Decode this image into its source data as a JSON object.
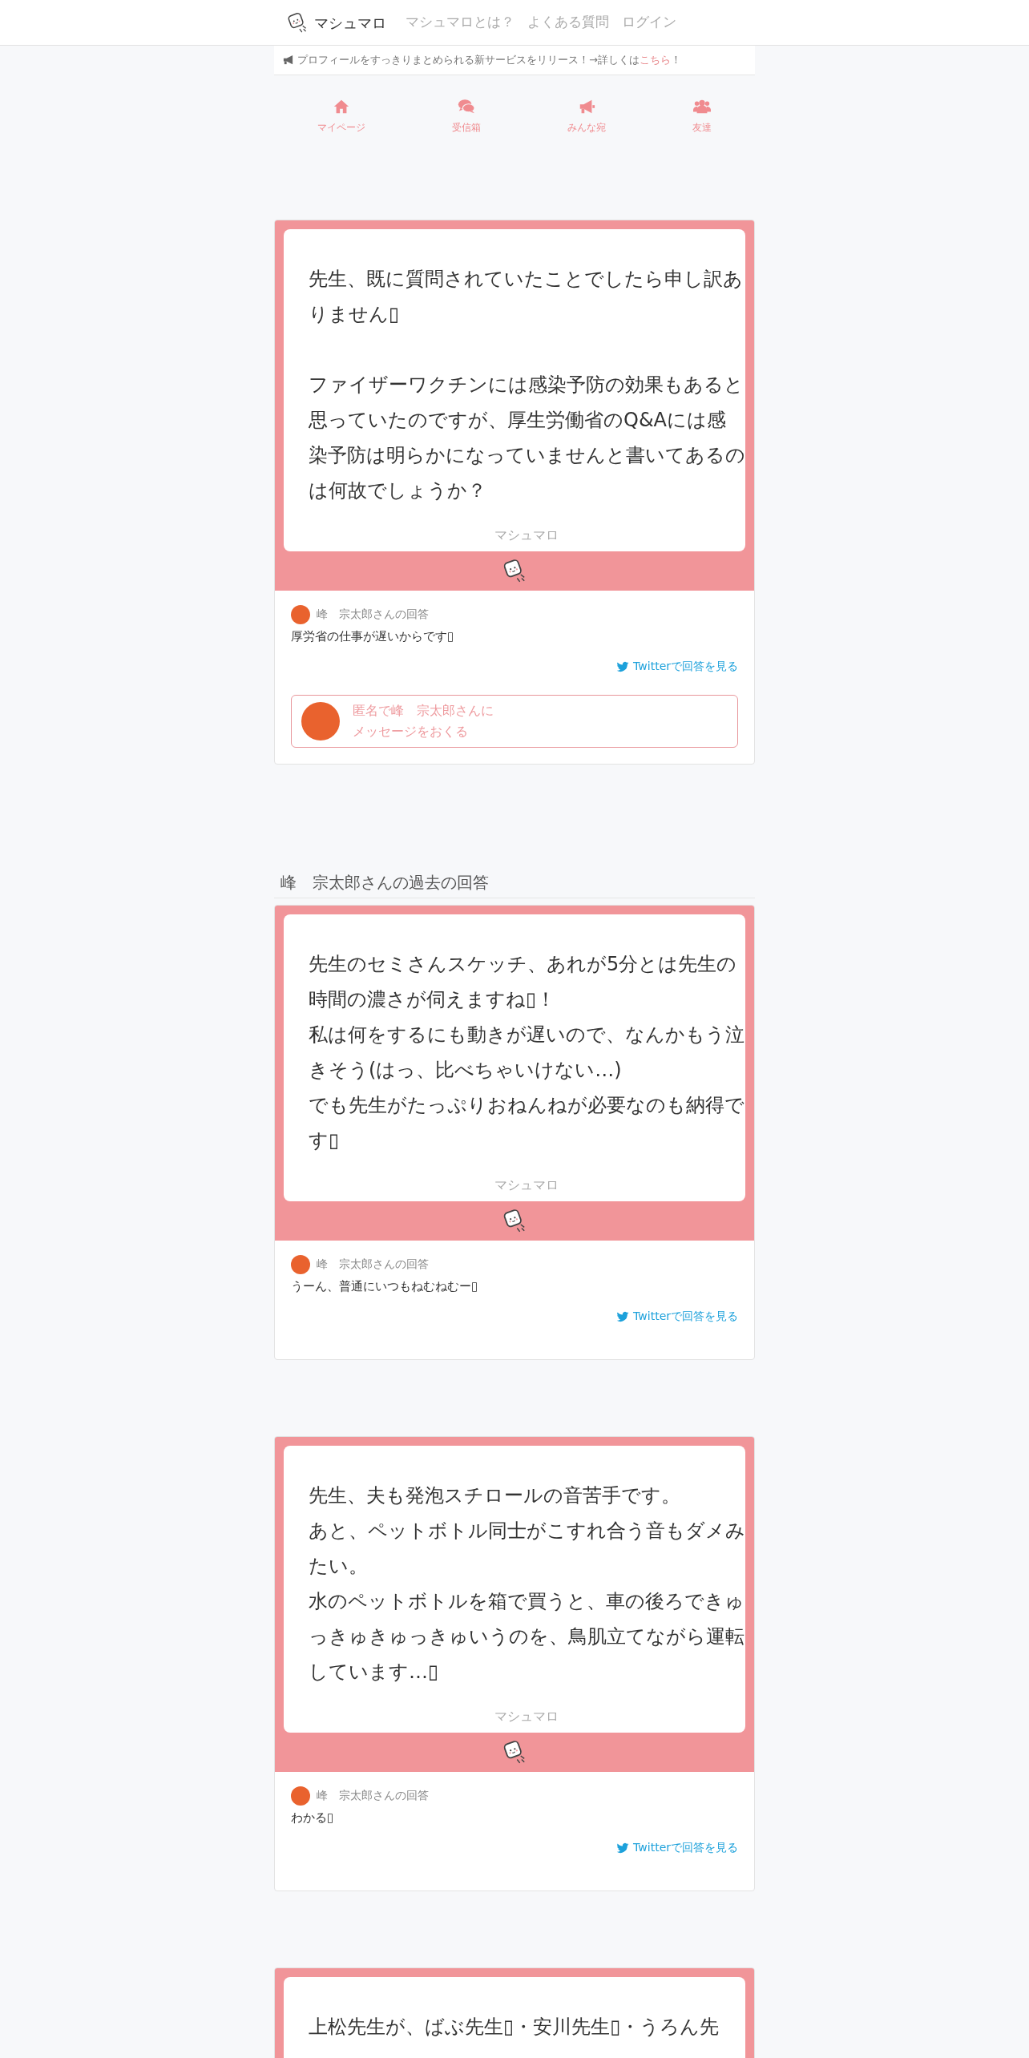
{
  "navbar": {
    "brand": "マシュマロ",
    "links": [
      "マシュマロとは？",
      "よくある質問",
      "ログイン"
    ]
  },
  "notice": {
    "text": "プロフィールをすっきりまとめられる新サービスをリリース！→詳しくは",
    "link": "こちら",
    "suffix": "！"
  },
  "tabs": [
    {
      "label": "マイページ",
      "kind": "home"
    },
    {
      "label": "受信箱",
      "kind": "chat"
    },
    {
      "label": "みんな宛",
      "kind": "megaphone"
    },
    {
      "label": "友達",
      "kind": "people"
    }
  ],
  "featured": {
    "question": [
      [
        "先生、既に質問されていたことでしたら申し訳ありません▯"
      ],
      [
        "ファイザーワクチンには感染予防の効果もあると思っていたのですが、厚生労働省のQ&Aには感染予防は明らかになっていませんと書いてあるのは何故でしょうか？"
      ]
    ],
    "watermark": "マシュマロ",
    "answer": {
      "author": "峰　宗太郎さんの回答",
      "text": "厚労省の仕事が遅いからです▯",
      "link": "Twitterで回答を見る"
    },
    "message_button": {
      "line_1": "匿名で峰　宗太郎さんに",
      "line_2": "メッセージをおくる"
    }
  },
  "past_answers": {
    "heading": "峰　宗太郎さんの過去の回答",
    "posts": [
      {
        "question": [
          [
            "先生のセミさんスケッチ、あれが5分とは先生の時間の濃さが伺えますね▯！",
            "私は何をするにも動きが遅いので、なんかもう泣きそう(はっ、比べちゃいけない…)",
            "でも先生がたっぷりおねんねが必要なのも納得です▯"
          ]
        ],
        "watermark": "マシュマロ",
        "answer": {
          "author": "峰　宗太郎さんの回答",
          "text": "うーん、普通にいつもねむねむー▯",
          "link": "Twitterで回答を見る"
        }
      },
      {
        "question": [
          [
            "先生、夫も発泡スチロールの音苦手です。",
            "あと、ペットボトル同士がこすれ合う音もダメみたい。",
            "水のペットボトルを箱で買うと、車の後ろできゅっきゅきゅっきゅいうのを、鳥肌立てながら運転しています…▯"
          ]
        ],
        "watermark": "マシュマロ",
        "answer": {
          "author": "峰　宗太郎さんの回答",
          "text": "わかる▯",
          "link": "Twitterで回答を見る"
        }
      },
      {
        "question": [
          [
            "上松先生が、ばぶ先生▯・安川先生▯・うろん先"
          ]
        ]
      }
    ]
  }
}
